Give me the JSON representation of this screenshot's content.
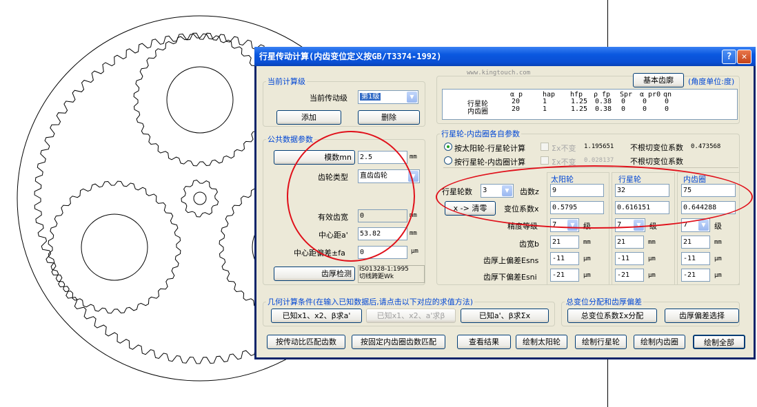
{
  "window": {
    "title": "行星传动计算(内齿变位定义按GB/T3374-1992)",
    "help_label": "?",
    "close_label": "✕",
    "watermark": "www.kingtouch.com"
  },
  "current_stage": {
    "legend": "当前计算级",
    "label": "当前传动级",
    "value": "第1级",
    "add_label": "添加",
    "delete_label": "删除"
  },
  "common": {
    "legend": "公共数据参数",
    "module_button": "模数mn",
    "module_value": "2.5",
    "module_unit": "mm",
    "gear_type_label": "齿轮类型",
    "gear_type_value": "直齿齿轮",
    "face_width_label": "有效齿宽",
    "face_width_value": "0",
    "face_width_unit": "mm",
    "center_distance_label": "中心距a'",
    "center_distance_value": "53.82",
    "center_distance_unit": "mm",
    "center_dev_label": "中心距偏差±fa",
    "center_dev_value": "0",
    "center_dev_unit": "μm",
    "thickness_check_button": "齿厚检测",
    "standard_line1": "IS01328-1:1995",
    "standard_line2": "切线跨距Wk"
  },
  "basic_rack": {
    "button": "基本齿廓",
    "note": "(角度单位:度)",
    "headers": [
      "α p",
      "hap",
      "hfp",
      "ρ fp",
      "Spr",
      "α pr0",
      "qn"
    ],
    "rows": [
      {
        "name": "行星轮",
        "values": [
          "20",
          "1",
          "1.25",
          "0.38",
          "0",
          "0",
          "0"
        ]
      },
      {
        "name": "内齿圈",
        "values": [
          "20",
          "1",
          "1.25",
          "0.38",
          "0",
          "0",
          "0"
        ]
      }
    ]
  },
  "params": {
    "legend": "行星轮-内齿圈各自参数",
    "radio1": "按太阳轮-行星轮计算",
    "radio2": "按行星轮-内齿圈计算",
    "sum_label": "Σx不变",
    "sum_value1": "1.195651",
    "undercut1_label": "不根切变位系数",
    "undercut1_value": "0.473568",
    "sum_value2": "0.028137",
    "undercut2_label": "不根切变位系数",
    "col_sun": "太阳轮",
    "col_planet": "行星轮",
    "col_ring": "内齿圈",
    "planet_count_label": "行星轮数",
    "planet_count_value": "3",
    "teeth_label": "齿数z",
    "teeth": [
      "9",
      "32",
      "75"
    ],
    "clear_button": "x -> 清零",
    "shift_label": "变位系数x",
    "shift": [
      "0.5795",
      "0.616151",
      "0.644288"
    ],
    "accuracy_label": "精度等级",
    "accuracy": [
      "7",
      "7",
      "7"
    ],
    "grade_unit": "级",
    "width_label": "齿宽b",
    "width": [
      "21",
      "21",
      "21"
    ],
    "width_unit": "mm",
    "upper_dev_label": "齿厚上偏差Esns",
    "upper_dev": [
      "-11",
      "-11",
      "-11"
    ],
    "lower_dev_label": "齿厚下偏差Esni",
    "lower_dev": [
      "-21",
      "-21",
      "-21"
    ],
    "dev_unit": "μm"
  },
  "geometry": {
    "legend": "几何计算条件(在输入已知数据后,请点击以下对应的求值方法)",
    "btn1": "已知x1、x2、β求a'",
    "btn2": "已知x1、x2、a'求β",
    "btn3": "已知a'、β求Σx"
  },
  "total_shift": {
    "legend": "总变位分配和齿厚偏差",
    "btn1": "总变位系数Σx分配",
    "btn2": "齿厚偏差选择"
  },
  "bottom": {
    "btn1": "按传动比匹配齿数",
    "btn2": "按固定内齿圈齿数匹配",
    "btn3": "查看结果",
    "btn4": "绘制太阳轮",
    "btn5": "绘制行星轮",
    "btn6": "绘制内齿圈",
    "btn7": "绘制全部"
  },
  "colors": {
    "title_blue": "#0a4fd4",
    "dialog_bg": "#ece9d8",
    "legend_blue": "#0046d5",
    "annotation_red": "#e0101a"
  }
}
